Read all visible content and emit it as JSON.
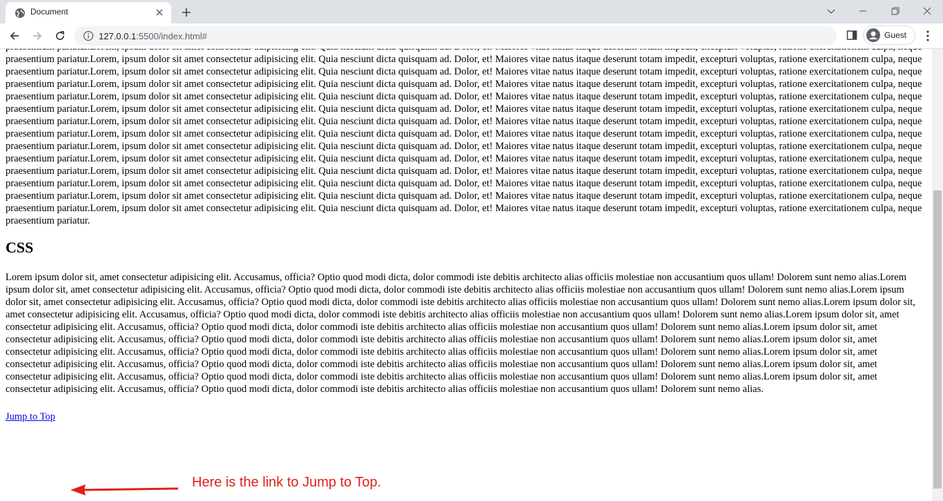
{
  "browser": {
    "tab_title": "Document",
    "url_host": "127.0.0.1",
    "url_path": ":5500/index.html#",
    "profile_label": "Guest"
  },
  "page": {
    "para1": "praesentium pariatur.Lorem, ipsum dolor sit amet consectetur adipisicing elit. Quia nesciunt dicta quisquam ad. Dolor, et! Maiores vitae natus itaque deserunt totam impedit, excepturi voluptas, ratione exercitationem culpa, neque praesentium pariatur.Lorem, ipsum dolor sit amet consectetur adipisicing elit. Quia nesciunt dicta quisquam ad. Dolor, et! Maiores vitae natus itaque deserunt totam impedit, excepturi voluptas, ratione exercitationem culpa, neque praesentium pariatur.Lorem, ipsum dolor sit amet consectetur adipisicing elit. Quia nesciunt dicta quisquam ad. Dolor, et! Maiores vitae natus itaque deserunt totam impedit, excepturi voluptas, ratione exercitationem culpa, neque praesentium pariatur.Lorem, ipsum dolor sit amet consectetur adipisicing elit. Quia nesciunt dicta quisquam ad. Dolor, et! Maiores vitae natus itaque deserunt totam impedit, excepturi voluptas, ratione exercitationem culpa, neque praesentium pariatur.Lorem, ipsum dolor sit amet consectetur adipisicing elit. Quia nesciunt dicta quisquam ad. Dolor, et! Maiores vitae natus itaque deserunt totam impedit, excepturi voluptas, ratione exercitationem culpa, neque praesentium pariatur.Lorem, ipsum dolor sit amet consectetur adipisicing elit. Quia nesciunt dicta quisquam ad. Dolor, et! Maiores vitae natus itaque deserunt totam impedit, excepturi voluptas, ratione exercitationem culpa, neque praesentium pariatur.Lorem, ipsum dolor sit amet consectetur adipisicing elit. Quia nesciunt dicta quisquam ad. Dolor, et! Maiores vitae natus itaque deserunt totam impedit, excepturi voluptas, ratione exercitationem culpa, neque praesentium pariatur.Lorem, ipsum dolor sit amet consectetur adipisicing elit. Quia nesciunt dicta quisquam ad. Dolor, et! Maiores vitae natus itaque deserunt totam impedit, excepturi voluptas, ratione exercitationem culpa, neque praesentium pariatur.Lorem, ipsum dolor sit amet consectetur adipisicing elit. Quia nesciunt dicta quisquam ad. Dolor, et! Maiores vitae natus itaque deserunt totam impedit, excepturi voluptas, ratione exercitationem culpa, neque praesentium pariatur.Lorem, ipsum dolor sit amet consectetur adipisicing elit. Quia nesciunt dicta quisquam ad. Dolor, et! Maiores vitae natus itaque deserunt totam impedit, excepturi voluptas, ratione exercitationem culpa, neque praesentium pariatur.Lorem, ipsum dolor sit amet consectetur adipisicing elit. Quia nesciunt dicta quisquam ad. Dolor, et! Maiores vitae natus itaque deserunt totam impedit, excepturi voluptas, ratione exercitationem culpa, neque praesentium pariatur.Lorem, ipsum dolor sit amet consectetur adipisicing elit. Quia nesciunt dicta quisquam ad. Dolor, et! Maiores vitae natus itaque deserunt totam impedit, excepturi voluptas, ratione exercitationem culpa, neque praesentium pariatur.Lorem, ipsum dolor sit amet consectetur adipisicing elit. Quia nesciunt dicta quisquam ad. Dolor, et! Maiores vitae natus itaque deserunt totam impedit, excepturi voluptas, ratione exercitationem culpa, neque praesentium pariatur.Lorem, ipsum dolor sit amet consectetur adipisicing elit. Quia nesciunt dicta quisquam ad. Dolor, et! Maiores vitae natus itaque deserunt totam impedit, excepturi voluptas, ratione exercitationem culpa, neque praesentium pariatur.",
    "section_heading": "CSS",
    "para2": "Lorem ipsum dolor sit, amet consectetur adipisicing elit. Accusamus, officia? Optio quod modi dicta, dolor commodi iste debitis architecto alias officiis molestiae non accusantium quos ullam! Dolorem sunt nemo alias.Lorem ipsum dolor sit, amet consectetur adipisicing elit. Accusamus, officia? Optio quod modi dicta, dolor commodi iste debitis architecto alias officiis molestiae non accusantium quos ullam! Dolorem sunt nemo alias.Lorem ipsum dolor sit, amet consectetur adipisicing elit. Accusamus, officia? Optio quod modi dicta, dolor commodi iste debitis architecto alias officiis molestiae non accusantium quos ullam! Dolorem sunt nemo alias.Lorem ipsum dolor sit, amet consectetur adipisicing elit. Accusamus, officia? Optio quod modi dicta, dolor commodi iste debitis architecto alias officiis molestiae non accusantium quos ullam! Dolorem sunt nemo alias.Lorem ipsum dolor sit, amet consectetur adipisicing elit. Accusamus, officia? Optio quod modi dicta, dolor commodi iste debitis architecto alias officiis molestiae non accusantium quos ullam! Dolorem sunt nemo alias.Lorem ipsum dolor sit, amet consectetur adipisicing elit. Accusamus, officia? Optio quod modi dicta, dolor commodi iste debitis architecto alias officiis molestiae non accusantium quos ullam! Dolorem sunt nemo alias.Lorem ipsum dolor sit, amet consectetur adipisicing elit. Accusamus, officia? Optio quod modi dicta, dolor commodi iste debitis architecto alias officiis molestiae non accusantium quos ullam! Dolorem sunt nemo alias.Lorem ipsum dolor sit, amet consectetur adipisicing elit. Accusamus, officia? Optio quod modi dicta, dolor commodi iste debitis architecto alias officiis molestiae non accusantium quos ullam! Dolorem sunt nemo alias.Lorem ipsum dolor sit, amet consectetur adipisicing elit. Accusamus, officia? Optio quod modi dicta, dolor commodi iste debitis architecto alias officiis molestiae non accusantium quos ullam! Dolorem sunt nemo alias.Lorem ipsum dolor sit, amet consectetur adipisicing elit. Accusamus, officia? Optio quod modi dicta, dolor commodi iste debitis architecto alias officiis molestiae non accusantium quos ullam! Dolorem sunt nemo alias.",
    "jump_link": "Jump to Top"
  },
  "annotation": {
    "text": "Here is the link to Jump to Top.",
    "color": "#e0201c"
  },
  "icons": {
    "tab": "globe-icon",
    "back": "back-arrow-icon",
    "forward": "forward-arrow-icon",
    "reload": "reload-icon",
    "site_info": "info-icon",
    "side_panel": "side-panel-icon",
    "profile": "avatar-icon",
    "menu": "kebab-menu-icon"
  }
}
